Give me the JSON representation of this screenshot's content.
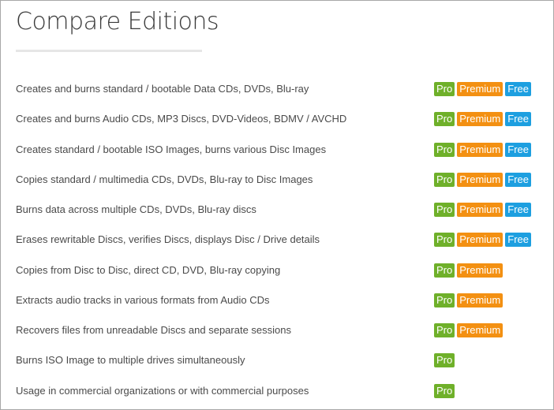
{
  "page": {
    "title": "Compare Editions"
  },
  "colors": {
    "pro": "#6fb02a",
    "premium": "#f39012",
    "free": "#1d9fe0"
  },
  "badge_labels": {
    "pro": "Pro",
    "premium": "Premium",
    "free": "Free"
  },
  "features": [
    {
      "label": "Creates and burns standard / bootable Data CDs, DVDs, Blu-ray",
      "editions": [
        "pro",
        "premium",
        "free"
      ]
    },
    {
      "label": "Creates and burns Audio CDs, MP3 Discs, DVD-Videos, BDMV / AVCHD",
      "editions": [
        "pro",
        "premium",
        "free"
      ]
    },
    {
      "label": "Creates standard / bootable ISO Images, burns various Disc Images",
      "editions": [
        "pro",
        "premium",
        "free"
      ]
    },
    {
      "label": "Copies standard / multimedia CDs, DVDs, Blu-ray to Disc Images",
      "editions": [
        "pro",
        "premium",
        "free"
      ]
    },
    {
      "label": "Burns data across multiple CDs, DVDs, Blu-ray discs",
      "editions": [
        "pro",
        "premium",
        "free"
      ]
    },
    {
      "label": "Erases rewritable Discs, verifies Discs, displays Disc / Drive details",
      "editions": [
        "pro",
        "premium",
        "free"
      ]
    },
    {
      "label": "Copies from Disc to Disc, direct CD, DVD, Blu-ray copying",
      "editions": [
        "pro",
        "premium"
      ]
    },
    {
      "label": "Extracts audio tracks in various formats from Audio CDs",
      "editions": [
        "pro",
        "premium"
      ]
    },
    {
      "label": "Recovers files from unreadable Discs and separate sessions",
      "editions": [
        "pro",
        "premium"
      ]
    },
    {
      "label": "Burns ISO Image to multiple drives simultaneously",
      "editions": [
        "pro"
      ]
    },
    {
      "label": "Usage in commercial organizations or with commercial purposes",
      "editions": [
        "pro"
      ]
    }
  ]
}
